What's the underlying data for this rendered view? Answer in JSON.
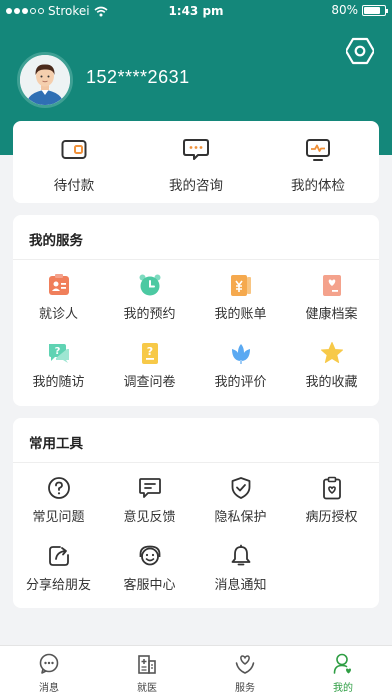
{
  "status_bar": {
    "carrier": "Strokei",
    "time": "1:43 pm",
    "battery": "80%"
  },
  "profile": {
    "phone": "152****2631"
  },
  "quick_actions": [
    {
      "label": "待付款",
      "icon": "wallet-icon"
    },
    {
      "label": "我的咨询",
      "icon": "chat-icon"
    },
    {
      "label": "我的体检",
      "icon": "monitor-icon"
    }
  ],
  "services": {
    "title": "我的服务",
    "items": [
      {
        "label": "就诊人",
        "icon": "patient-card-icon",
        "color": "#f07f5b"
      },
      {
        "label": "我的预约",
        "icon": "alarm-clock-icon",
        "color": "#4cc9a2"
      },
      {
        "label": "我的账单",
        "icon": "bill-icon",
        "color": "#f5a94e"
      },
      {
        "label": "健康档案",
        "icon": "health-record-icon",
        "color": "#f4a28c"
      },
      {
        "label": "我的随访",
        "icon": "followup-chat-icon",
        "color": "#5fd3b3"
      },
      {
        "label": "调查问卷",
        "icon": "questionnaire-icon",
        "color": "#f7c948"
      },
      {
        "label": "我的评价",
        "icon": "tulip-icon",
        "color": "#5aa9f2"
      },
      {
        "label": "我的收藏",
        "icon": "star-icon",
        "color": "#f7c948"
      }
    ]
  },
  "tools": {
    "title": "常用工具",
    "items": [
      {
        "label": "常见问题",
        "icon": "question-icon"
      },
      {
        "label": "意见反馈",
        "icon": "feedback-icon"
      },
      {
        "label": "隐私保护",
        "icon": "shield-icon"
      },
      {
        "label": "病历授权",
        "icon": "clipboard-heart-icon"
      },
      {
        "label": "分享给朋友",
        "icon": "share-icon"
      },
      {
        "label": "客服中心",
        "icon": "customer-service-icon"
      },
      {
        "label": "消息通知",
        "icon": "bell-icon"
      }
    ]
  },
  "tabbar": [
    {
      "label": "消息",
      "icon": "message-icon"
    },
    {
      "label": "就医",
      "icon": "hospital-icon"
    },
    {
      "label": "服务",
      "icon": "heart-hands-icon"
    },
    {
      "label": "我的",
      "icon": "profile-icon",
      "active": true
    }
  ],
  "colors": {
    "header": "#14877a",
    "active_tab": "#2f9e44"
  }
}
